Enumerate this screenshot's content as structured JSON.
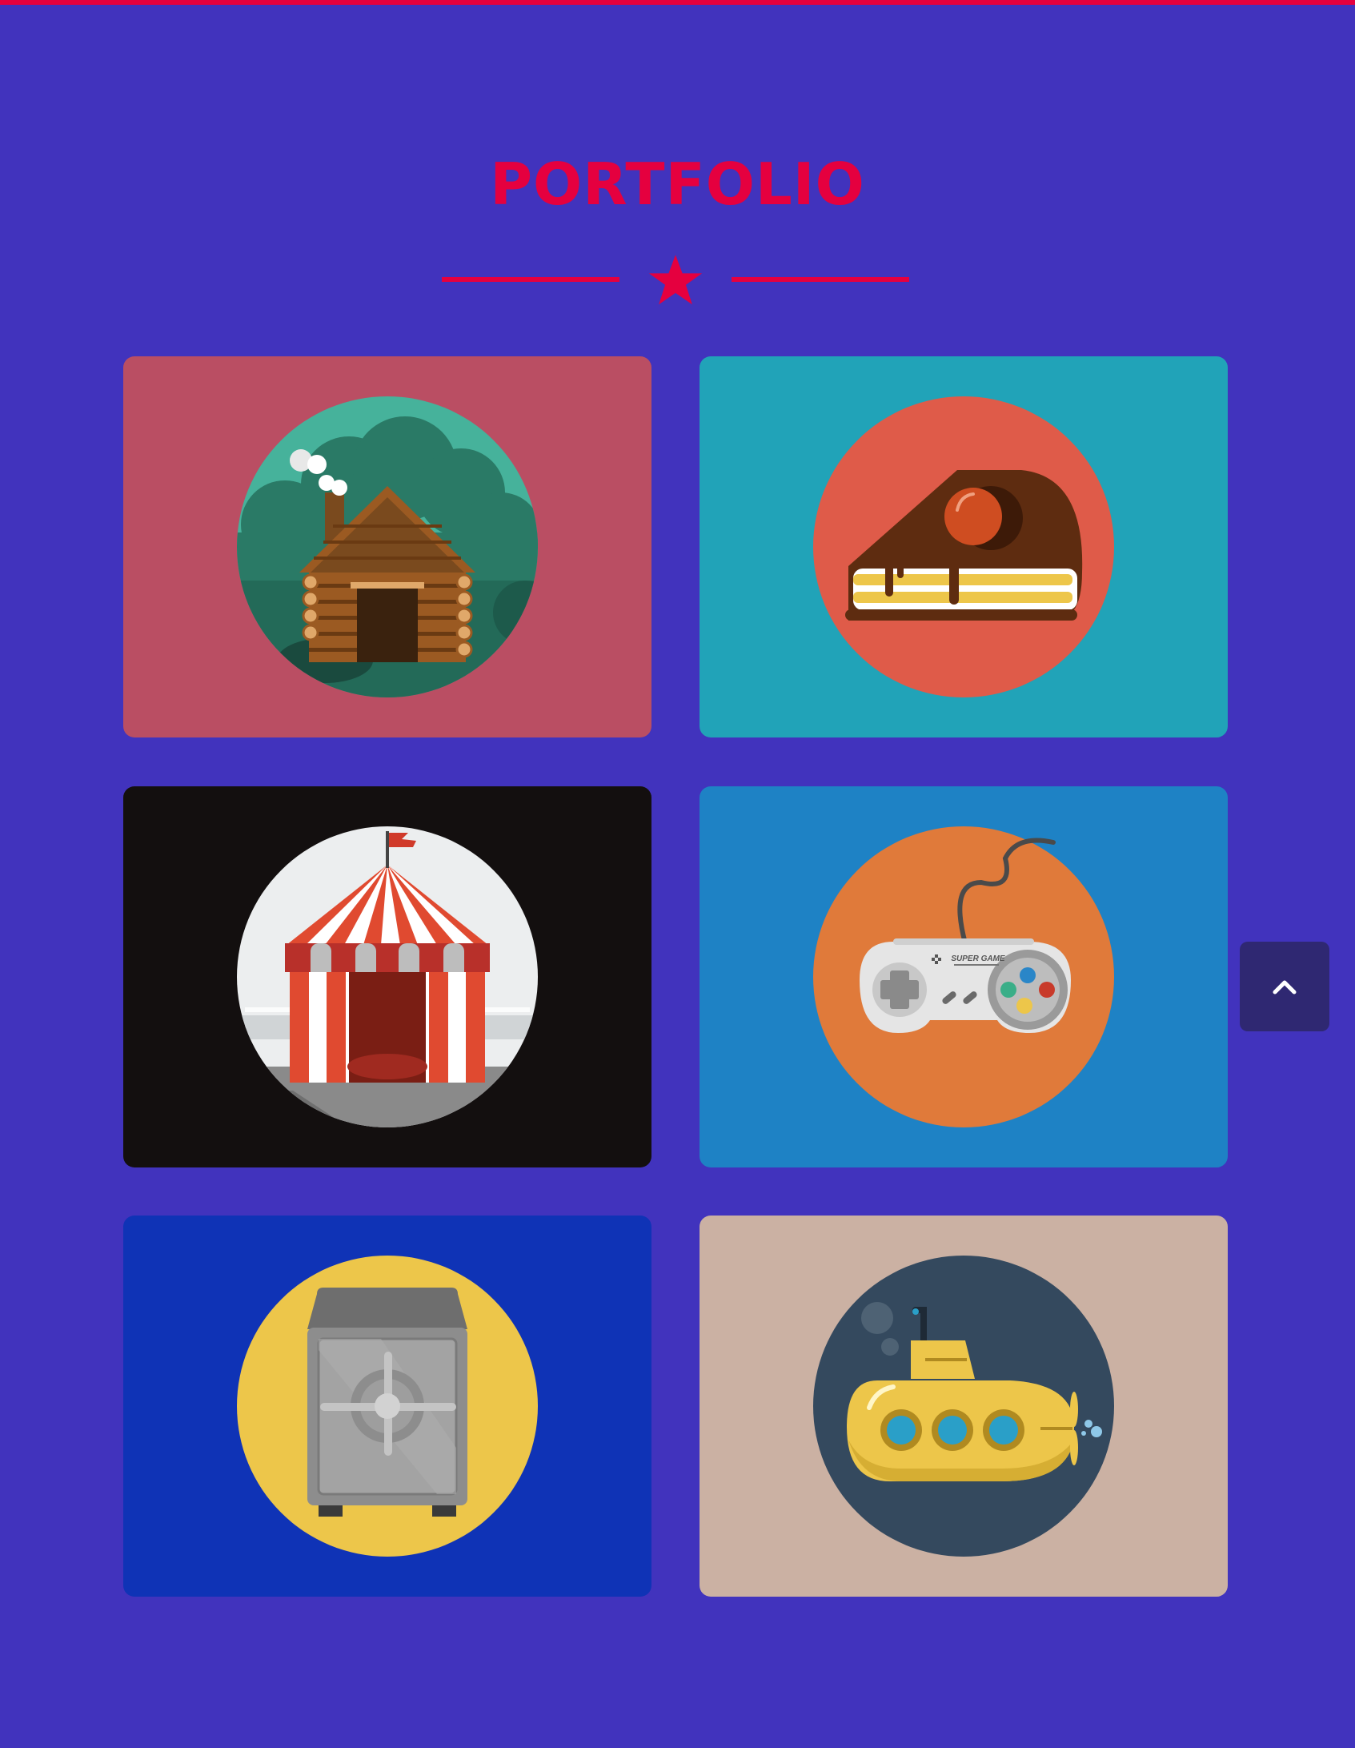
{
  "section": {
    "title": "PORTFOLIO",
    "accent_color": "#E5003F",
    "divider_icon": "star-icon"
  },
  "portfolio": {
    "items": [
      {
        "id": "cabin",
        "icon": "log-cabin-icon",
        "bg": "#BA4E63",
        "circle": "#2A7A66"
      },
      {
        "id": "cake",
        "icon": "cake-slice-icon",
        "bg": "#21A3B8",
        "circle": "#DF5B49"
      },
      {
        "id": "circus",
        "icon": "circus-tent-icon",
        "bg": "#130F0F",
        "circle": "#ECEEEF"
      },
      {
        "id": "gamepad",
        "icon": "game-controller-icon",
        "bg": "#1E82C5",
        "circle": "#E07A3A"
      },
      {
        "id": "safe",
        "icon": "safe-icon",
        "bg": "#0F33B6",
        "circle": "#EDC64A"
      },
      {
        "id": "submarine",
        "icon": "submarine-icon",
        "bg": "#CBB1A3",
        "circle": "#34495E"
      }
    ],
    "gamepad_label": "SUPER GAME"
  },
  "scroll_top": {
    "icon": "chevron-up-icon"
  }
}
